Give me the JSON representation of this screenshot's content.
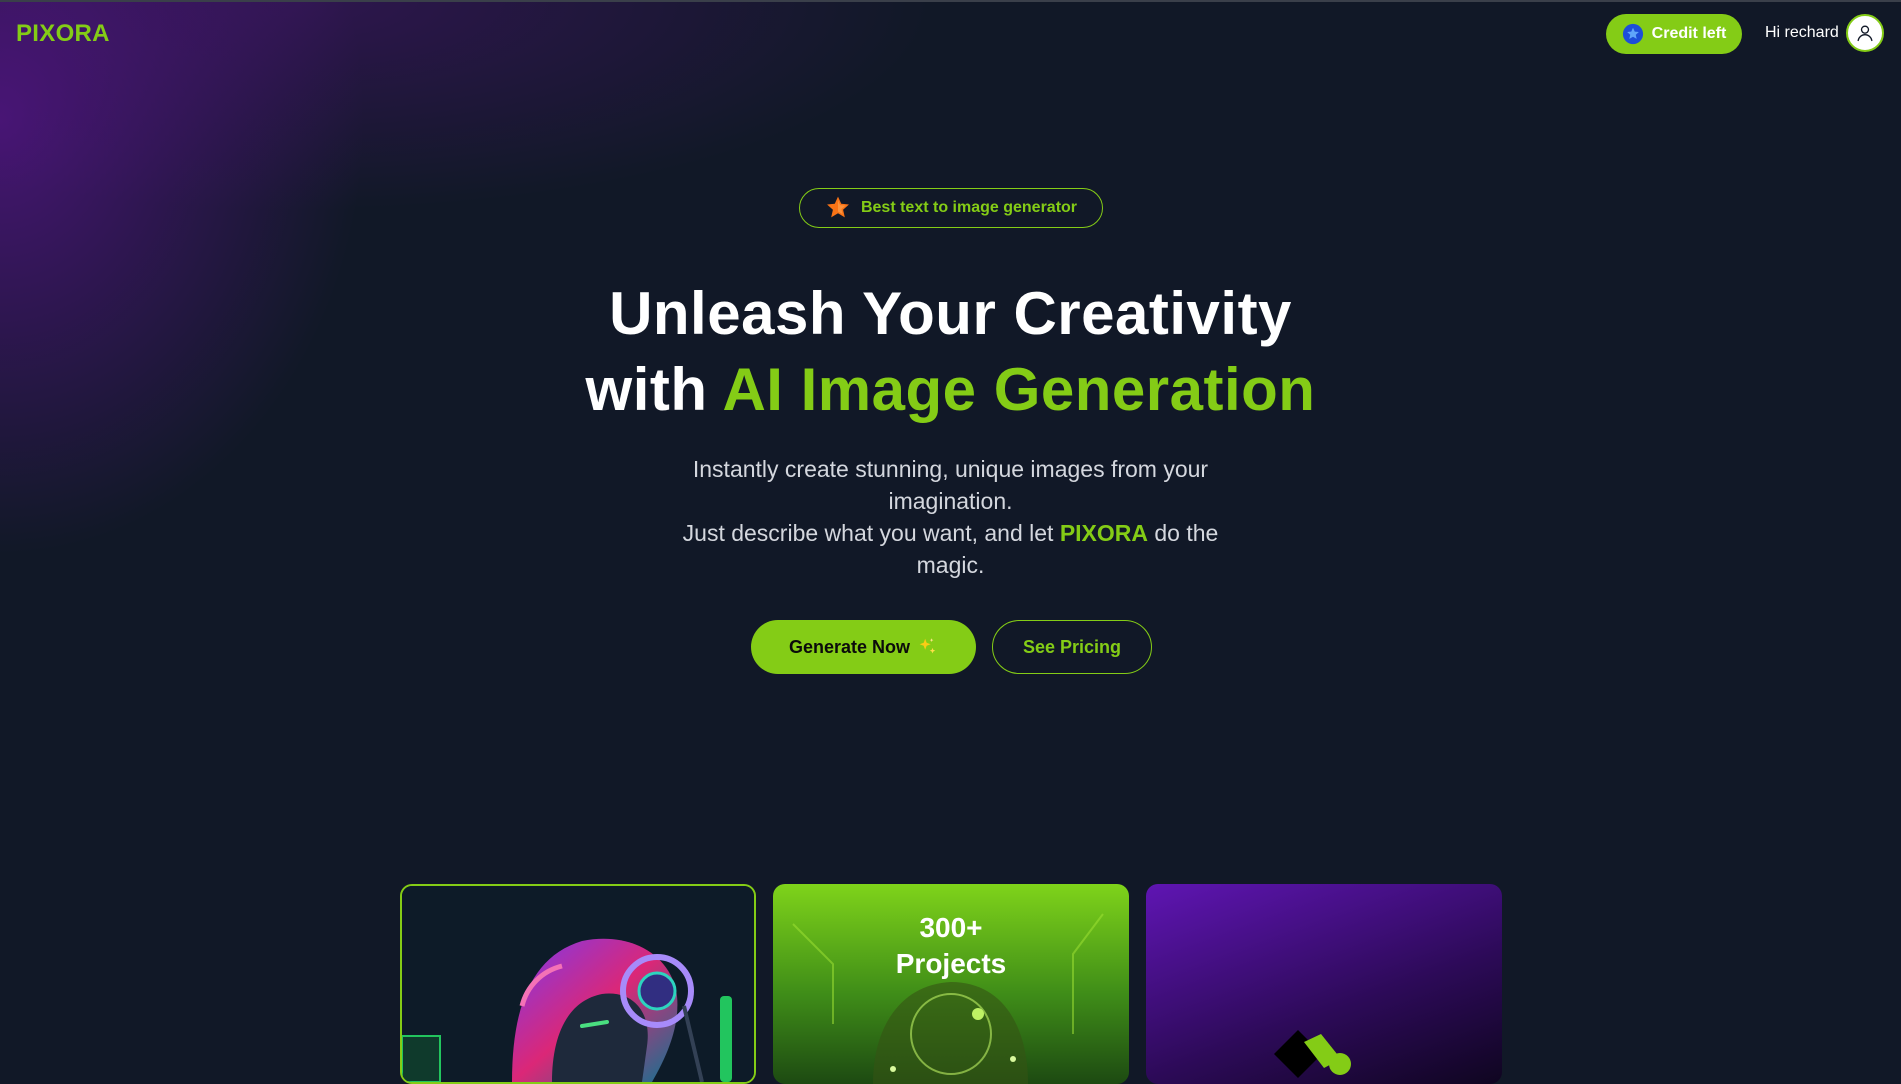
{
  "brand": {
    "logo": "PIXORA",
    "accent_color": "#84cc16",
    "background_color": "#111827"
  },
  "header": {
    "credit_button_label": "Credit left",
    "credit_icon": "star-icon",
    "greeting": "Hi rechard",
    "avatar_icon": "user-icon"
  },
  "hero": {
    "badge_icon": "star-icon",
    "badge_text": "Best text to image generator",
    "headline_line1": "Unleash Your Creativity",
    "headline_line2_prefix": "with ",
    "headline_line2_accent": "AI Image Generation",
    "subtext_line1": "Instantly create stunning, unique images from your imagination.",
    "subtext_line2_prefix": "Just describe what you want, and let ",
    "subtext_brand": "PIXORA",
    "subtext_line2_suffix": " do the magic.",
    "primary_cta": "Generate Now",
    "primary_cta_icon": "sparkles-icon",
    "secondary_cta": "See Pricing"
  },
  "cards": [
    {
      "image": "robot-headphones-image"
    },
    {
      "title_line1": "300+",
      "title_line2": "Projects",
      "image": "robot-head-image"
    },
    {
      "image": "logo-shape-image"
    }
  ]
}
